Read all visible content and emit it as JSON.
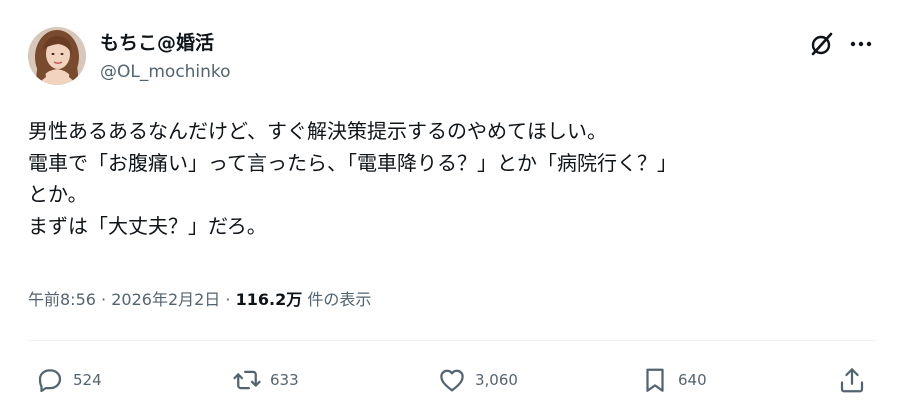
{
  "author": {
    "display_name": "もちこ@婚活",
    "handle": "@OL_mochinko",
    "avatar_icon": "profile-photo"
  },
  "header_icons": [
    "grok-icon",
    "more-icon"
  ],
  "post": {
    "lines": [
      "男性あるあるなんだけど、すぐ解決策提示するのやめてほしい。",
      "電車で「お腹痛い」って言ったら、「電車降りる？」とか「病院行く？」",
      "とか。",
      "まずは「大丈夫？」だろ。"
    ]
  },
  "meta": {
    "time": "午前8:56",
    "separator": "·",
    "date": "2026年2月2日",
    "views_count": "116.2万",
    "views_label": "件の表示"
  },
  "actions": {
    "reply_count": "524",
    "repost_count": "633",
    "like_count": "3,060",
    "bookmark_count": "640"
  },
  "colors": {
    "text_primary": "#0f1419",
    "text_secondary": "#536471",
    "divider": "#eff3f4",
    "background": "#ffffff"
  }
}
